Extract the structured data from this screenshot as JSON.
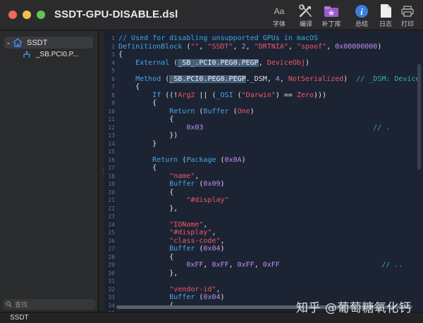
{
  "window": {
    "title": "SSDT-GPU-DISABLE.dsl"
  },
  "toolbar": [
    {
      "label": "字体",
      "icon": "font-icon"
    },
    {
      "label": "编译",
      "icon": "compile-tools-icon"
    },
    {
      "label": "补丁库",
      "icon": "patch-library-icon"
    },
    {
      "label": "总结",
      "icon": "info-icon"
    },
    {
      "label": "日志",
      "icon": "log-document-icon"
    },
    {
      "label": "打印",
      "icon": "print-icon"
    }
  ],
  "sidebar": {
    "root": {
      "label": "SSDT",
      "icon": "home-icon"
    },
    "child": {
      "label": "_SB.PCI0.P...",
      "icon": "device-tree-icon"
    },
    "search_placeholder": "查找"
  },
  "editor": {
    "lines": [
      {
        "n": "1",
        "tokens": [
          [
            "c-com",
            "// Used for disabling unsupported GPUs in macOS"
          ]
        ]
      },
      {
        "n": "2",
        "tokens": [
          [
            "c-kw",
            "DefinitionBlock"
          ],
          [
            "c-plain",
            " ("
          ],
          [
            "c-str",
            "\"\""
          ],
          [
            "c-plain",
            ", "
          ],
          [
            "c-str",
            "\"SSDT\""
          ],
          [
            "c-plain",
            ", "
          ],
          [
            "c-num",
            "2"
          ],
          [
            "c-plain",
            ", "
          ],
          [
            "c-str",
            "\"DRTNIA\""
          ],
          [
            "c-plain",
            ", "
          ],
          [
            "c-str",
            "\"spoof\""
          ],
          [
            "c-plain",
            ", "
          ],
          [
            "c-num",
            "0x00000000"
          ],
          [
            "c-plain",
            ")"
          ]
        ]
      },
      {
        "n": "3",
        "tokens": [
          [
            "c-plain",
            "{"
          ]
        ]
      },
      {
        "n": "4",
        "tokens": [
          [
            "c-plain",
            "    "
          ],
          [
            "c-kw",
            "External"
          ],
          [
            "c-plain",
            " ("
          ],
          [
            "c-hl",
            "_SB_.PCI0.PEG0.PEGP"
          ],
          [
            "c-plain",
            ", "
          ],
          [
            "c-str",
            "DeviceObj"
          ],
          [
            "c-plain",
            ")"
          ]
        ]
      },
      {
        "n": "5",
        "tokens": []
      },
      {
        "n": "6",
        "tokens": [
          [
            "c-plain",
            "    "
          ],
          [
            "c-kw",
            "Method"
          ],
          [
            "c-plain",
            " ("
          ],
          [
            "c-hl",
            "_SB.PCI0.PEG0.PEGP"
          ],
          [
            "c-plain",
            "._DSM, "
          ],
          [
            "c-num",
            "4"
          ],
          [
            "c-plain",
            ", "
          ],
          [
            "c-str",
            "NotSerialized"
          ],
          [
            "c-plain",
            ")  "
          ],
          [
            "c-cmt2",
            "// _DSM: Device"
          ]
        ]
      },
      {
        "n": "7",
        "tokens": [
          [
            "c-plain",
            "    {"
          ]
        ]
      },
      {
        "n": "8",
        "tokens": [
          [
            "c-plain",
            "        "
          ],
          [
            "c-kw",
            "If"
          ],
          [
            "c-plain",
            " ((!"
          ],
          [
            "c-str",
            "Arg2"
          ],
          [
            "c-plain",
            " || ("
          ],
          [
            "c-kw",
            "_OSI"
          ],
          [
            "c-plain",
            " ("
          ],
          [
            "c-str",
            "\"Darwin\""
          ],
          [
            "c-plain",
            ") == "
          ],
          [
            "c-str",
            "Zero"
          ],
          [
            "c-plain",
            ")))"
          ]
        ]
      },
      {
        "n": "9",
        "tokens": [
          [
            "c-plain",
            "        {"
          ]
        ]
      },
      {
        "n": "10",
        "tokens": [
          [
            "c-plain",
            "            "
          ],
          [
            "c-kw",
            "Return"
          ],
          [
            "c-plain",
            " ("
          ],
          [
            "c-kw",
            "Buffer"
          ],
          [
            "c-plain",
            " ("
          ],
          [
            "c-str",
            "One"
          ],
          [
            "c-plain",
            ")"
          ]
        ]
      },
      {
        "n": "11",
        "tokens": [
          [
            "c-plain",
            "            {"
          ]
        ]
      },
      {
        "n": "12",
        "tokens": [
          [
            "c-plain",
            "                "
          ],
          [
            "c-num",
            "0x03"
          ],
          [
            "c-plain",
            "                                        "
          ],
          [
            "c-cmt2",
            "// ."
          ]
        ]
      },
      {
        "n": "13",
        "tokens": [
          [
            "c-plain",
            "            })"
          ]
        ]
      },
      {
        "n": "14",
        "tokens": [
          [
            "c-plain",
            "        }"
          ]
        ]
      },
      {
        "n": "15",
        "tokens": []
      },
      {
        "n": "16",
        "tokens": [
          [
            "c-plain",
            "        "
          ],
          [
            "c-kw",
            "Return"
          ],
          [
            "c-plain",
            " ("
          ],
          [
            "c-kw",
            "Package"
          ],
          [
            "c-plain",
            " ("
          ],
          [
            "c-num",
            "0x0A"
          ],
          [
            "c-plain",
            ")"
          ]
        ]
      },
      {
        "n": "17",
        "tokens": [
          [
            "c-plain",
            "        {"
          ]
        ]
      },
      {
        "n": "18",
        "tokens": [
          [
            "c-plain",
            "            "
          ],
          [
            "c-str",
            "\"name\""
          ],
          [
            "c-plain",
            ","
          ]
        ]
      },
      {
        "n": "19",
        "tokens": [
          [
            "c-plain",
            "            "
          ],
          [
            "c-kw",
            "Buffer"
          ],
          [
            "c-plain",
            " ("
          ],
          [
            "c-num",
            "0x09"
          ],
          [
            "c-plain",
            ")"
          ]
        ]
      },
      {
        "n": "20",
        "tokens": [
          [
            "c-plain",
            "            {"
          ]
        ]
      },
      {
        "n": "21",
        "tokens": [
          [
            "c-plain",
            "                "
          ],
          [
            "c-str",
            "\"#display\""
          ]
        ]
      },
      {
        "n": "22",
        "tokens": [
          [
            "c-plain",
            "            },"
          ]
        ]
      },
      {
        "n": "23",
        "tokens": []
      },
      {
        "n": "24",
        "tokens": [
          [
            "c-plain",
            "            "
          ],
          [
            "c-str",
            "\"IOName\""
          ],
          [
            "c-plain",
            ","
          ]
        ]
      },
      {
        "n": "25",
        "tokens": [
          [
            "c-plain",
            "            "
          ],
          [
            "c-str",
            "\"#display\""
          ],
          [
            "c-plain",
            ","
          ]
        ]
      },
      {
        "n": "26",
        "tokens": [
          [
            "c-plain",
            "            "
          ],
          [
            "c-str",
            "\"class-code\""
          ],
          [
            "c-plain",
            ","
          ]
        ]
      },
      {
        "n": "27",
        "tokens": [
          [
            "c-plain",
            "            "
          ],
          [
            "c-kw",
            "Buffer"
          ],
          [
            "c-plain",
            " ("
          ],
          [
            "c-num",
            "0x04"
          ],
          [
            "c-plain",
            ")"
          ]
        ]
      },
      {
        "n": "28",
        "tokens": [
          [
            "c-plain",
            "            {"
          ]
        ]
      },
      {
        "n": "29",
        "tokens": [
          [
            "c-plain",
            "                "
          ],
          [
            "c-num",
            "0xFF"
          ],
          [
            "c-plain",
            ", "
          ],
          [
            "c-num",
            "0xFF"
          ],
          [
            "c-plain",
            ", "
          ],
          [
            "c-num",
            "0xFF"
          ],
          [
            "c-plain",
            ", "
          ],
          [
            "c-num",
            "0xFF"
          ],
          [
            "c-plain",
            "                        "
          ],
          [
            "c-cmt2",
            "// .."
          ]
        ]
      },
      {
        "n": "30",
        "tokens": [
          [
            "c-plain",
            "            },"
          ]
        ]
      },
      {
        "n": "31",
        "tokens": []
      },
      {
        "n": "32",
        "tokens": [
          [
            "c-plain",
            "            "
          ],
          [
            "c-str",
            "\"vendor-id\""
          ],
          [
            "c-plain",
            ","
          ]
        ]
      },
      {
        "n": "33",
        "tokens": [
          [
            "c-plain",
            "            "
          ],
          [
            "c-kw",
            "Buffer"
          ],
          [
            "c-plain",
            " ("
          ],
          [
            "c-num",
            "0x04"
          ],
          [
            "c-plain",
            ")"
          ]
        ]
      },
      {
        "n": "34",
        "tokens": [
          [
            "c-plain",
            "            {"
          ]
        ]
      },
      {
        "n": "35",
        "tokens": []
      }
    ]
  },
  "statusbar": {
    "text": "SSDT"
  },
  "watermark": "知乎 @葡萄糖氧化钙",
  "colors": {
    "keyword": "#4aa3e8",
    "string": "#f0566a",
    "number": "#c08cf0",
    "comment": "#3fa7d8",
    "highlight": "#46607a"
  }
}
